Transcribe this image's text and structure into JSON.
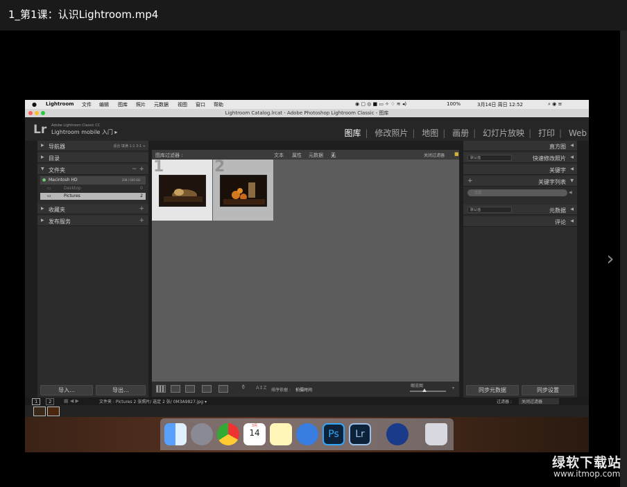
{
  "window": {
    "title": "1_第1课：认识Lightroom.mp4"
  },
  "macbar": {
    "apple": "",
    "app": "Lightroom",
    "menus": [
      "文件",
      "编辑",
      "图库",
      "照片",
      "元数据",
      "视图",
      "窗口",
      "帮助"
    ],
    "battery": "100%",
    "clock": "3月14日 周日  12:52"
  },
  "app_window": {
    "title": "Lightroom Catalog.lrcat - Adobe Photoshop Lightroom Classic - 图库"
  },
  "lightroom": {
    "logo": "Lr",
    "subtitle_small": "Adobe Lightroom Classic CC",
    "subtitle": "Lightroom mobile 入门  ▸",
    "modules": [
      "图库",
      "修改照片",
      "地图",
      "画册",
      "幻灯片放映",
      "打印",
      "Web"
    ],
    "active_module": "图库"
  },
  "left_panel": {
    "navigator": "导航器",
    "navigator_opts": "适合   填满   1:1   3:1  ÷",
    "catalog": "目录",
    "folders": "文件夹",
    "volume_name": "Macintosh HD",
    "volume_size": "208 / 500 GB",
    "folder_desktop": "Desktop",
    "folder_desktop_count": "0",
    "folder_pictures": "Pictures",
    "folder_pictures_count": "2",
    "collections": "收藏夹",
    "publish": "发布服务",
    "import_btn": "导入...",
    "export_btn": "导出..."
  },
  "filter_bar": {
    "label": "图库过滤器 :",
    "options": [
      "文本",
      "属性",
      "元数据",
      "无"
    ],
    "close": "关闭过滤器"
  },
  "grid": {
    "cells": [
      {
        "number": "1"
      },
      {
        "number": "2"
      }
    ]
  },
  "toolbar": {
    "sort_label": "排序依据 :",
    "sort_value": "拍摄时间",
    "thumb_label": "缩览图"
  },
  "right_panel": {
    "histogram": "直方图",
    "quick_develop": "快速修改照片",
    "quick_develop_preset": "默认值",
    "keywording": "关键字",
    "keyword_list": "关键字列表",
    "keyword_filter": "过滤",
    "metadata_preset": "默认值",
    "metadata": "元数据",
    "comments": "评论",
    "sync_meta_btn": "同步元数据",
    "sync_settings_btn": "同步设置"
  },
  "filmstrip": {
    "page1": "1",
    "page2": "2",
    "path": "文件夹 : Pictures   2 张照片/ 选定 2 张/ 0M3A9827.jpg ▾",
    "filter_label": "过滤器 :",
    "filter_value": "关闭过滤器"
  },
  "dock": {
    "icons": [
      "finder-icon",
      "launchpad-icon",
      "chrome-icon",
      "calendar-icon",
      "notes-icon",
      "pages-icon",
      "photoshop-icon",
      "lightroom-icon",
      "quicktime-icon",
      "trash-icon"
    ],
    "calendar_month": "3月",
    "calendar_day": "14",
    "ps": "Ps",
    "lr": "Lr"
  },
  "watermark": {
    "brand": "绿软下载站",
    "url": "www.itmop.com"
  }
}
